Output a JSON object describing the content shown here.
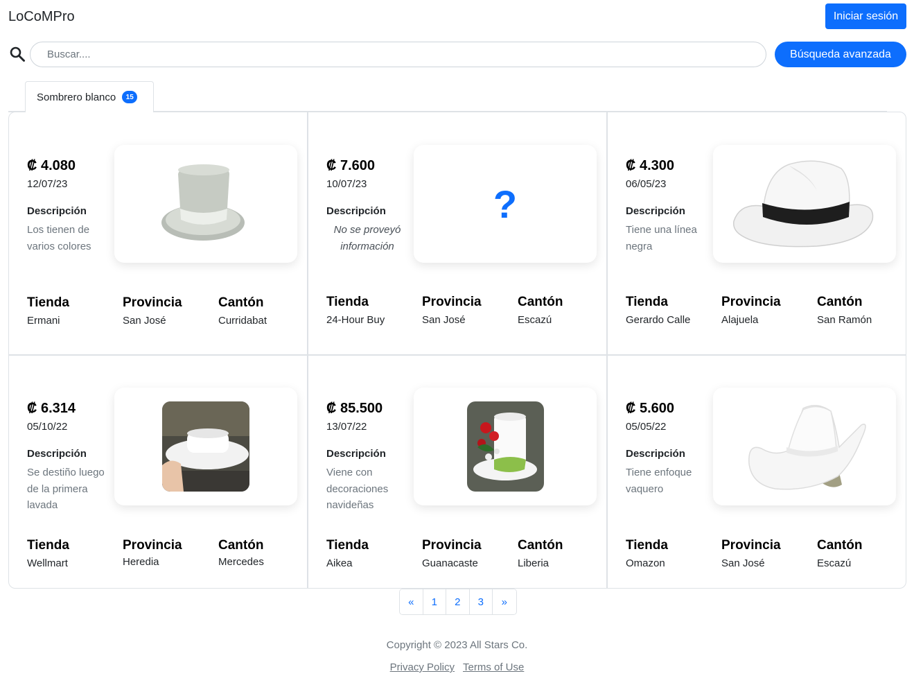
{
  "header": {
    "brand": "LoCoMPro",
    "login_label": "Iniciar sesión"
  },
  "search": {
    "placeholder": "Buscar....",
    "value": "",
    "advanced_label": "Búsqueda avanzada"
  },
  "tab": {
    "label": "Sombrero blanco",
    "count": "15"
  },
  "labels": {
    "description": "Descripción",
    "store": "Tienda",
    "province": "Provincia",
    "canton": "Cantón"
  },
  "results": [
    {
      "price": "₡ 4.080",
      "date": "12/07/23",
      "description": "Los tienen de varios colores",
      "store": "Ermani",
      "province": "San José",
      "canton": "Curridabat",
      "image": "gray-top-hat"
    },
    {
      "price": "₡ 7.600",
      "date": "10/07/23",
      "description": "No se proveyó información",
      "store": "24-Hour Buy",
      "province": "San José",
      "canton": "Escazú",
      "image": "question-mark-icon"
    },
    {
      "price": "₡ 4.300",
      "date": "06/05/23",
      "description": "Tiene una línea negra",
      "store": "Gerardo Calle",
      "province": "Alajuela",
      "canton": "San Ramón",
      "image": "white-fedora-black-band"
    },
    {
      "price": "₡ 6.314",
      "date": "05/10/22",
      "description": "Se destiño luego de la primera lavada",
      "store": "Wellmart",
      "province": "Heredia",
      "canton": "Mercedes",
      "image": "white-pork-pie-hat-photo"
    },
    {
      "price": "₡ 85.500",
      "date": "13/07/22",
      "description": "Viene con decoraciones navideñas",
      "store": "Aikea",
      "province": "Guanacaste",
      "canton": "Liberia",
      "image": "christmas-decorated-hat-photo"
    },
    {
      "price": "₡ 5.600",
      "date": "05/05/22",
      "description": "Tiene enfoque vaquero",
      "store": "Omazon",
      "province": "San José",
      "canton": "Escazú",
      "image": "white-cowboy-hat"
    }
  ],
  "pagination": {
    "prev": "«",
    "pages": [
      "1",
      "2",
      "3"
    ],
    "next": "»"
  },
  "footer": {
    "copyright": "Copyright © 2023 All Stars Co.",
    "privacy": "Privacy Policy",
    "terms": "Terms of Use"
  },
  "colors": {
    "primary": "#0d6efd",
    "muted": "#6c757d",
    "border": "#dee2e6"
  }
}
